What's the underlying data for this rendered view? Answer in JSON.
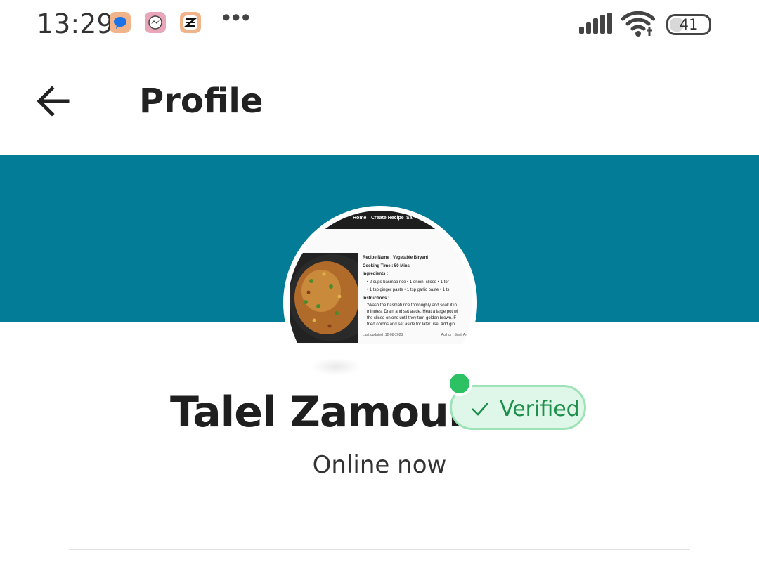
{
  "status_bar": {
    "time": "13:29",
    "battery": "41",
    "battery_level": 0.41,
    "notification_icons": [
      "messages-icon",
      "messenger-icon",
      "capcut-icon"
    ],
    "overflow": "•••"
  },
  "app_bar": {
    "title": "Profile",
    "back_icon": "arrow-left-icon"
  },
  "profile": {
    "name": "Talel Zamouri",
    "verified_label": "Verified",
    "status": "Online now",
    "online_color": "#2cc162",
    "cover_color": "#027c97"
  },
  "avatar_image": {
    "nav_items": [
      "Home",
      "Create Recipe",
      "Sa"
    ],
    "recipe_name": "Recipe Name : Vegetable Biryani",
    "cooking_time": "Cooking Time : 50 Mins",
    "ingredients_heading": "Ingredients :",
    "ingredients": [
      "•  2 cups basmati rice  •  1 onion, sliced  •  1 tor",
      "•  1 tsp ginger paste  •  1 tsp garlic paste  •  1 ts"
    ],
    "instructions_heading": "Instructions :",
    "instructions": [
      "\"Wash the basmati rice thoroughly and soak it in",
      "minutes. Drain and set aside. Heat a large pot wi",
      "the sliced onions until they turn golden brown. F",
      "fried onions and set aside for later use. Add gin"
    ],
    "last_updated": "Last updated :12-08-2023",
    "author": "Author : Sunil Aai"
  }
}
